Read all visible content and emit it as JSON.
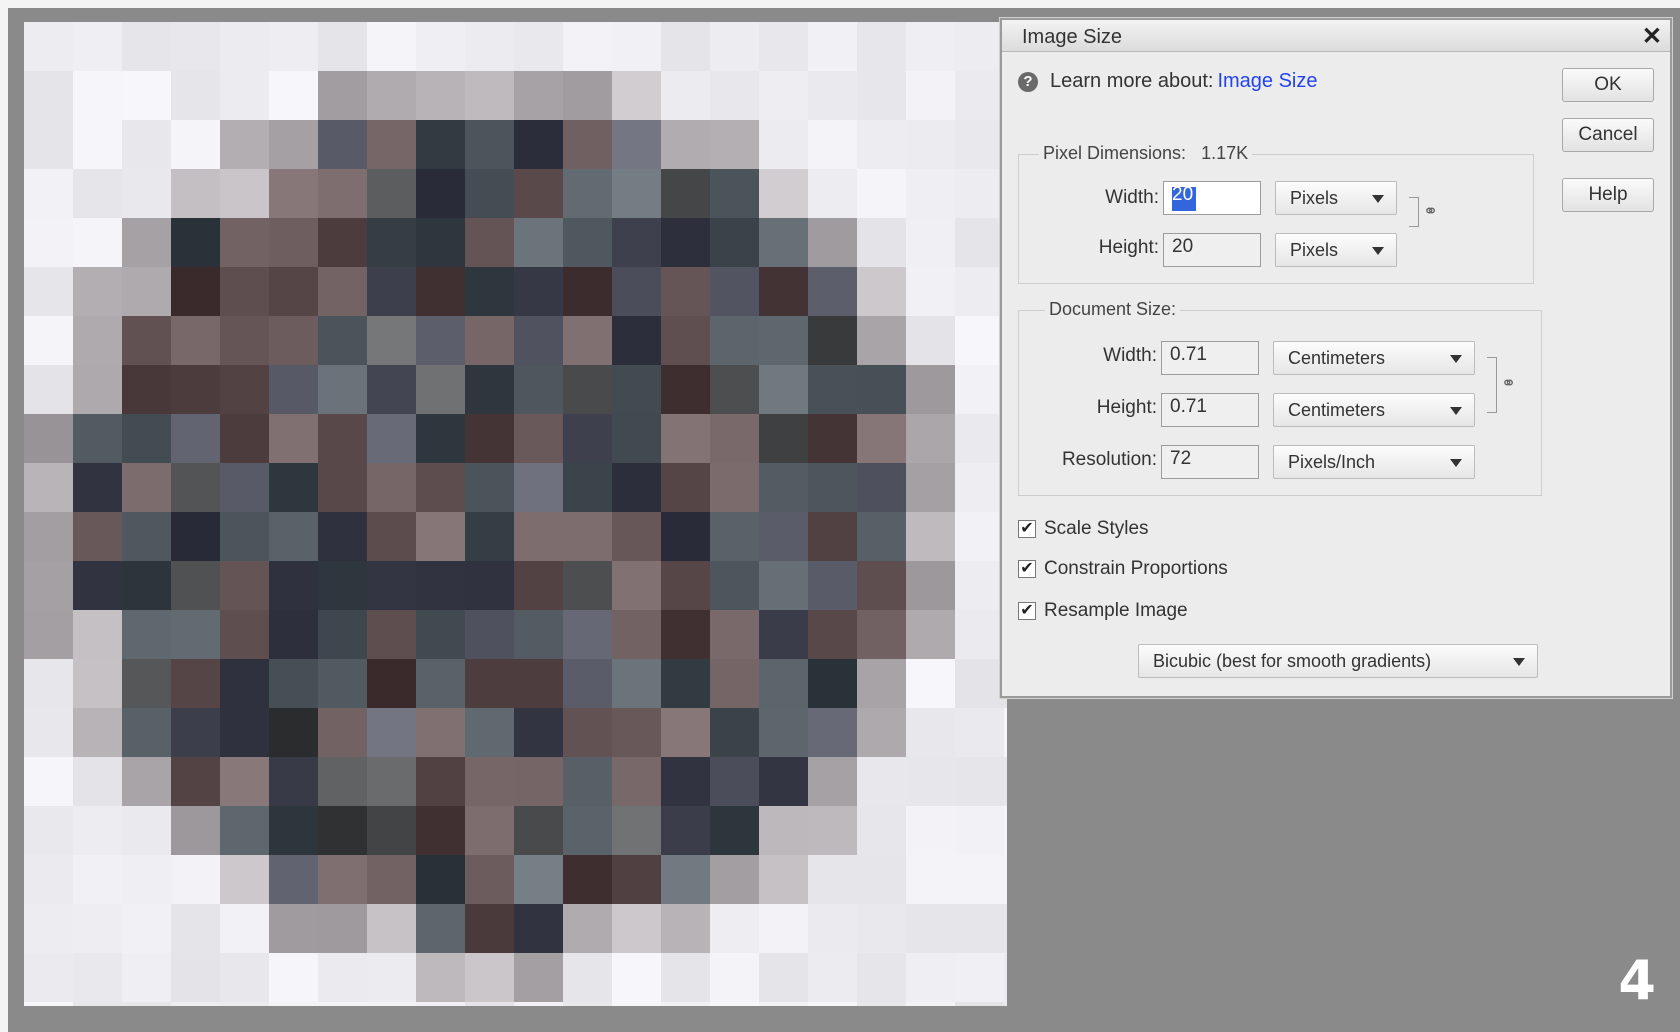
{
  "dialog": {
    "title": "Image Size",
    "close_glyph": "✕",
    "help_prefix": "Learn more about:",
    "help_link": "Image Size",
    "buttons": {
      "ok": "OK",
      "cancel": "Cancel",
      "help": "Help"
    },
    "pixel_dimensions": {
      "label": "Pixel Dimensions:",
      "size": "1.17K",
      "width_label": "Width:",
      "width_value": "20",
      "width_unit": "Pixels",
      "height_label": "Height:",
      "height_value": "20",
      "height_unit": "Pixels"
    },
    "document_size": {
      "label": "Document Size:",
      "width_label": "Width:",
      "width_value": "0.71",
      "width_unit": "Centimeters",
      "height_label": "Height:",
      "height_value": "0.71",
      "height_unit": "Centimeters",
      "resolution_label": "Resolution:",
      "resolution_value": "72",
      "resolution_unit": "Pixels/Inch"
    },
    "options": {
      "scale_styles": {
        "label": "Scale Styles",
        "checked": true
      },
      "constrain_proportions": {
        "label": "Constrain Proportions",
        "checked": true
      },
      "resample_image": {
        "label": "Resample Image",
        "checked": true
      },
      "resample_method": "Bicubic (best for smooth gradients)"
    }
  },
  "step_number": "4",
  "icons": {
    "help": "help-circle-icon",
    "chain": "chain-link-icon",
    "check": "checkmark-icon"
  }
}
